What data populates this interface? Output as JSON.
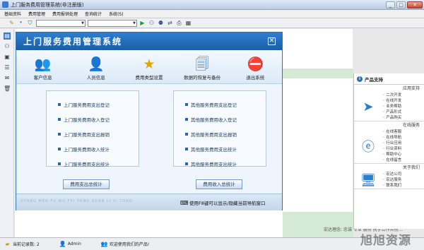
{
  "window": {
    "title": "上门服务费用管理系统(非注册版)",
    "min": "_",
    "max": "□",
    "close": "✕"
  },
  "menu": [
    "基础资料",
    "费用管理",
    "费用报销处理",
    "查询统计",
    "系统(S)"
  ],
  "toolbar": {
    "combo1": "",
    "combo2": ""
  },
  "dialog": {
    "title": "上门服务费用管理系统",
    "close": "✕",
    "icons": [
      {
        "label": "客户信息",
        "icon": "people-icon",
        "glyph": "👥",
        "color": "#2a7a3a"
      },
      {
        "label": "人员信息",
        "icon": "user-icon",
        "glyph": "👤",
        "color": "#2a8a3a"
      },
      {
        "label": "费用类型设置",
        "icon": "star-icon",
        "glyph": "★",
        "color": "#e2a400"
      },
      {
        "label": "数据的恢复与备份",
        "icon": "documents-icon",
        "glyph": "🗐",
        "color": "#3f6fae"
      },
      {
        "label": "退出系统",
        "icon": "exit-icon",
        "glyph": "⛔",
        "color": "#d02020"
      }
    ],
    "left_panel": [
      "上门服务费用支出登记",
      "上门服务费用收入登记",
      "上门服务费用支出报销",
      "上门服务费用收入统计",
      "上门服务费用支出统计"
    ],
    "right_panel": [
      "其他服务费用支出登记",
      "其他服务费用收入登记",
      "其他服务费用支出报销",
      "其他服务费用支出统计",
      "其他服务费用支出统计"
    ],
    "left_button": "费用支出总统计",
    "right_button": "费用收入总统计",
    "footer_pinyin": "SHANG MEN FU WU FEI YONG GUAN LI XI TONG",
    "footer_hint": "使用F8键可以显示/隐藏当前导航窗口"
  },
  "right_panel": {
    "header": "产品支持",
    "sections": [
      {
        "title": "应用支持",
        "icon": "arrow-icon",
        "glyph": "➤",
        "items": [
          "二次开发",
          "在线开发",
          "业务帮助",
          "产品形式",
          "产品购买"
        ]
      },
      {
        "title": "在线服务",
        "icon": "ie-icon",
        "glyph": "ⓔ",
        "items": [
          "在线客服",
          "在线导航",
          "行业应用",
          "行业资料",
          "帮助中心",
          "在线留言"
        ]
      },
      {
        "title": "关于我们",
        "icon": "monitor-icon",
        "glyph": "🖥",
        "items": [
          "宏达公司",
          "宏达服务",
          "联系我们"
        ]
      }
    ]
  },
  "bottom_text": "宏达理念: 忠诚  专业  服务  携手合作共创...",
  "status": {
    "records": "当前记录数: 2",
    "user": "Admin",
    "welcome": "欢迎使用我们的产品!"
  },
  "watermark": "旭旭资源"
}
